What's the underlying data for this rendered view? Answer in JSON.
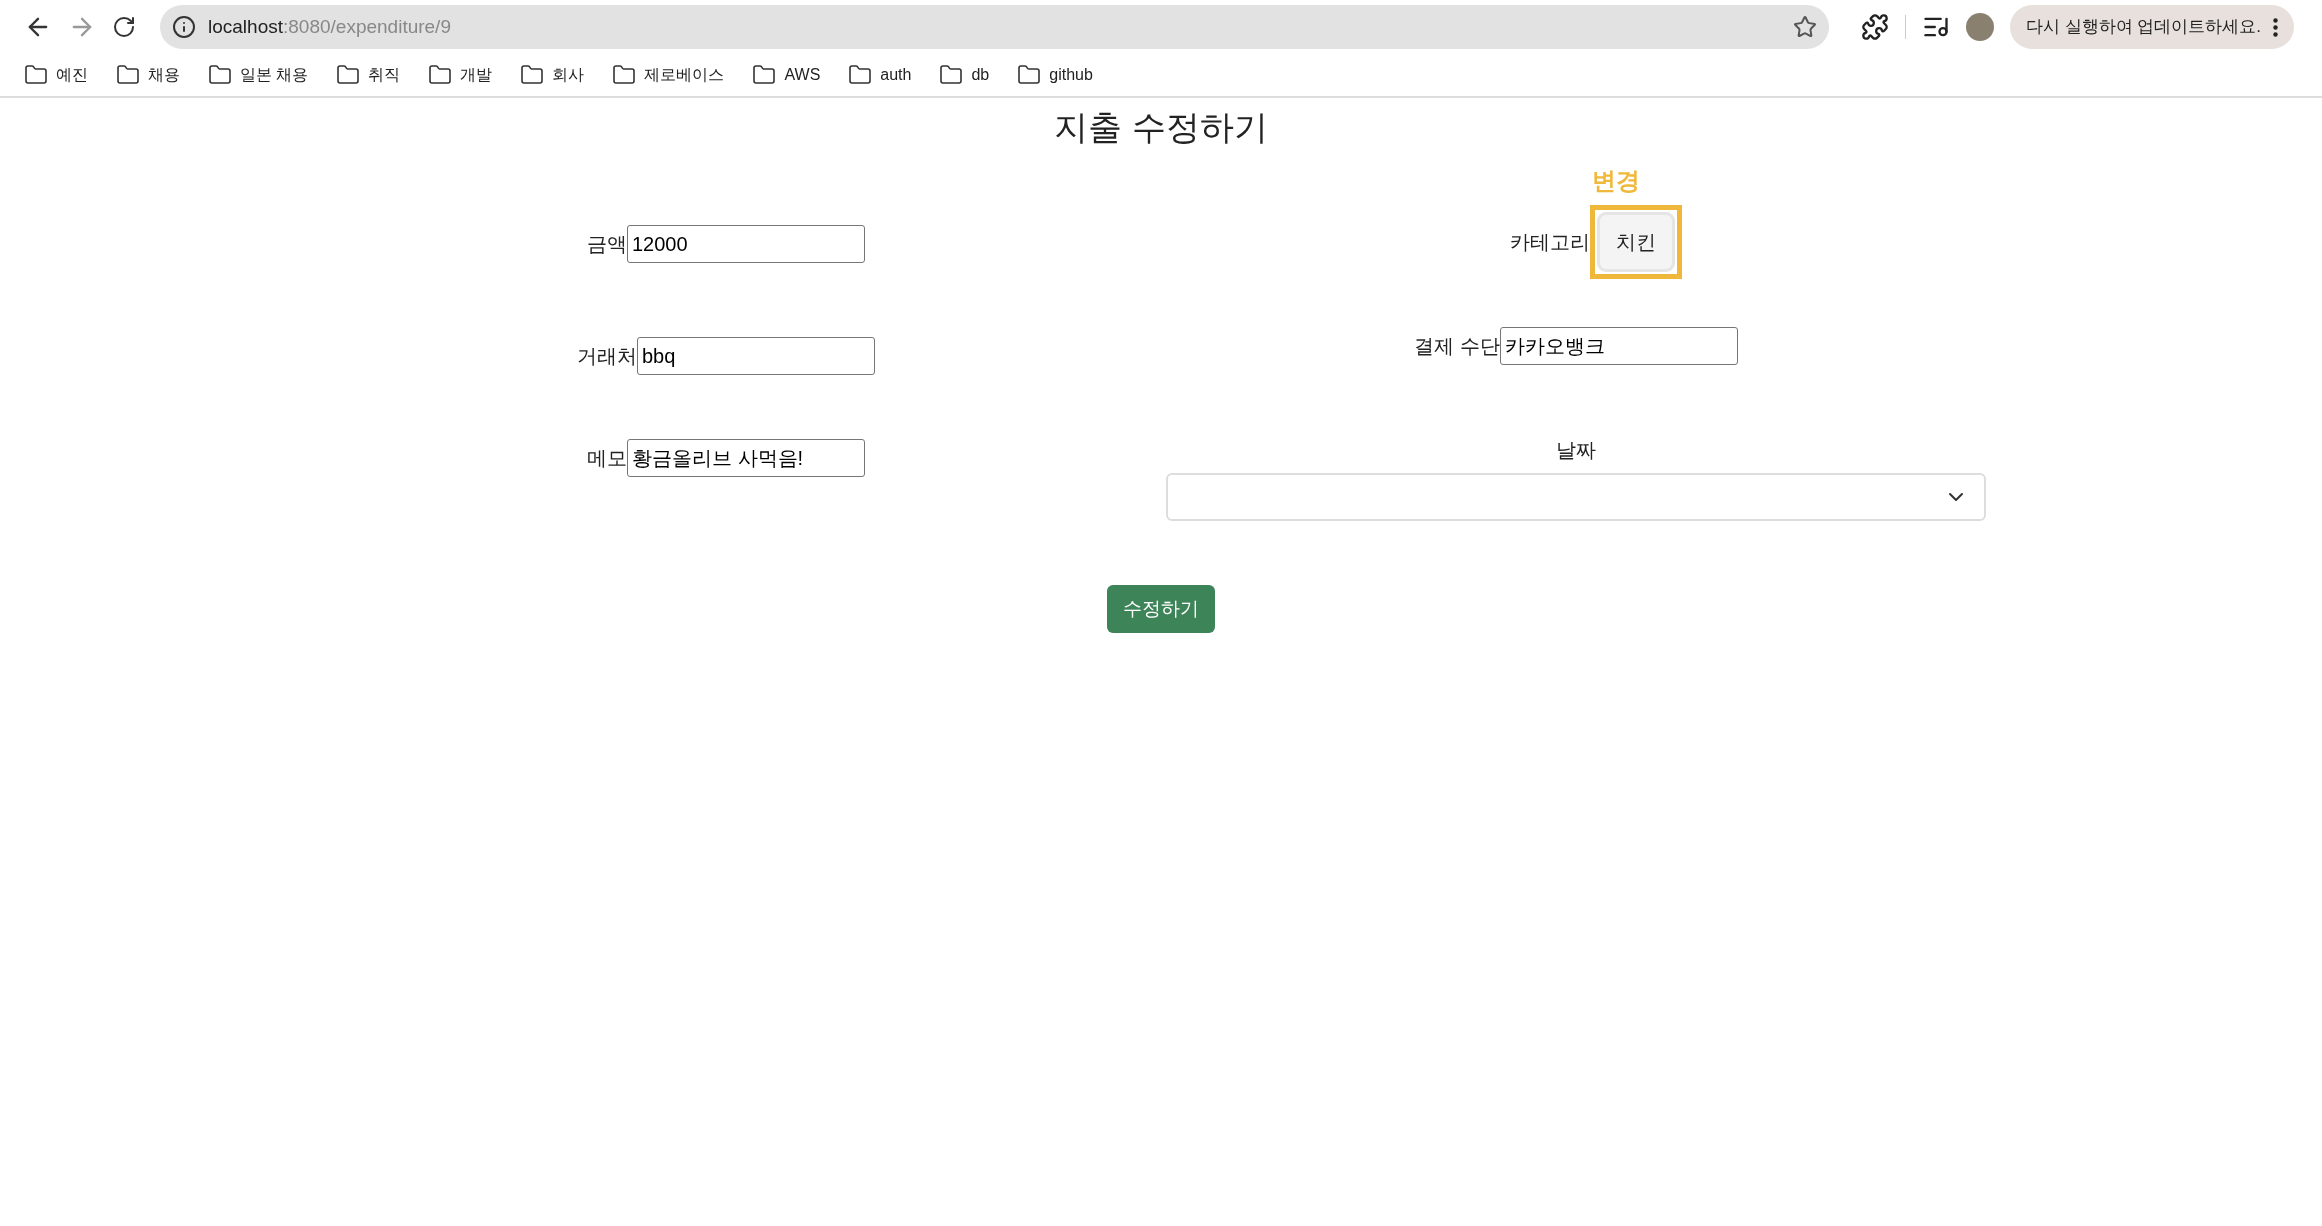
{
  "browser": {
    "url_host": "localhost",
    "url_path": ":8080/expenditure/9",
    "update_button": "다시 실행하여 업데이트하세요.",
    "bookmarks": [
      "예진",
      "채용",
      "일본 채용",
      "취직",
      "개발",
      "회사",
      "제로베이스",
      "AWS",
      "auth",
      "db",
      "github"
    ]
  },
  "page": {
    "title": "지출 수정하기",
    "left_fields": [
      {
        "label": "금액",
        "value": "12000"
      },
      {
        "label": "거래처",
        "value": "bbq"
      },
      {
        "label": "메모",
        "value": "황금올리브 사먹음!"
      }
    ],
    "category": {
      "label": "카테고리",
      "value": "치킨",
      "highlighted": true,
      "annotation": "변경"
    },
    "payment": {
      "label": "결제 수단",
      "value": "카카오뱅크"
    },
    "date": {
      "label": "날짜"
    },
    "submit": "수정하기"
  }
}
